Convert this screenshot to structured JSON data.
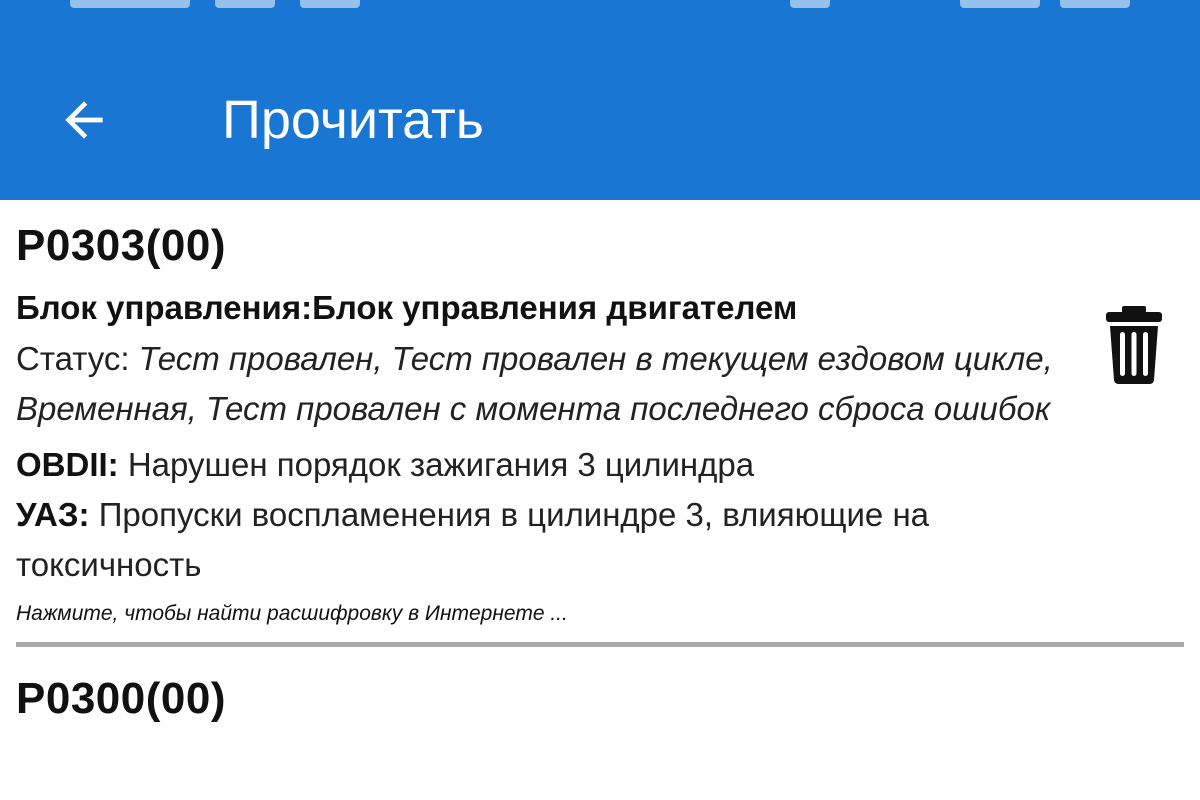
{
  "app_bar": {
    "title": "Прочитать",
    "back_icon": "arrow-back-icon",
    "color": "#1976d2"
  },
  "dtc_list": [
    {
      "code": "P0303(00)",
      "ecu_label": "Блок управления:",
      "ecu_value": "Блок управления двигателем",
      "status_label": "Статус: ",
      "status_value": "Тест провален, Тест провален в текущем ездовом цикле, Временная, Тест провален с момента последнего сброса ошибок",
      "obd_label": "OBDII:",
      "obd_value": " Нарушен порядок зажигания 3 цилиндра",
      "maker_label": "УАЗ:",
      "maker_value": " Пропуски воспламенения в цилиндре 3, влияющие на токсичность",
      "hint": "Нажмите, чтобы найти расшифровку в Интернете ...",
      "delete_icon": "trash-icon"
    },
    {
      "code": "P0300(00)"
    }
  ]
}
